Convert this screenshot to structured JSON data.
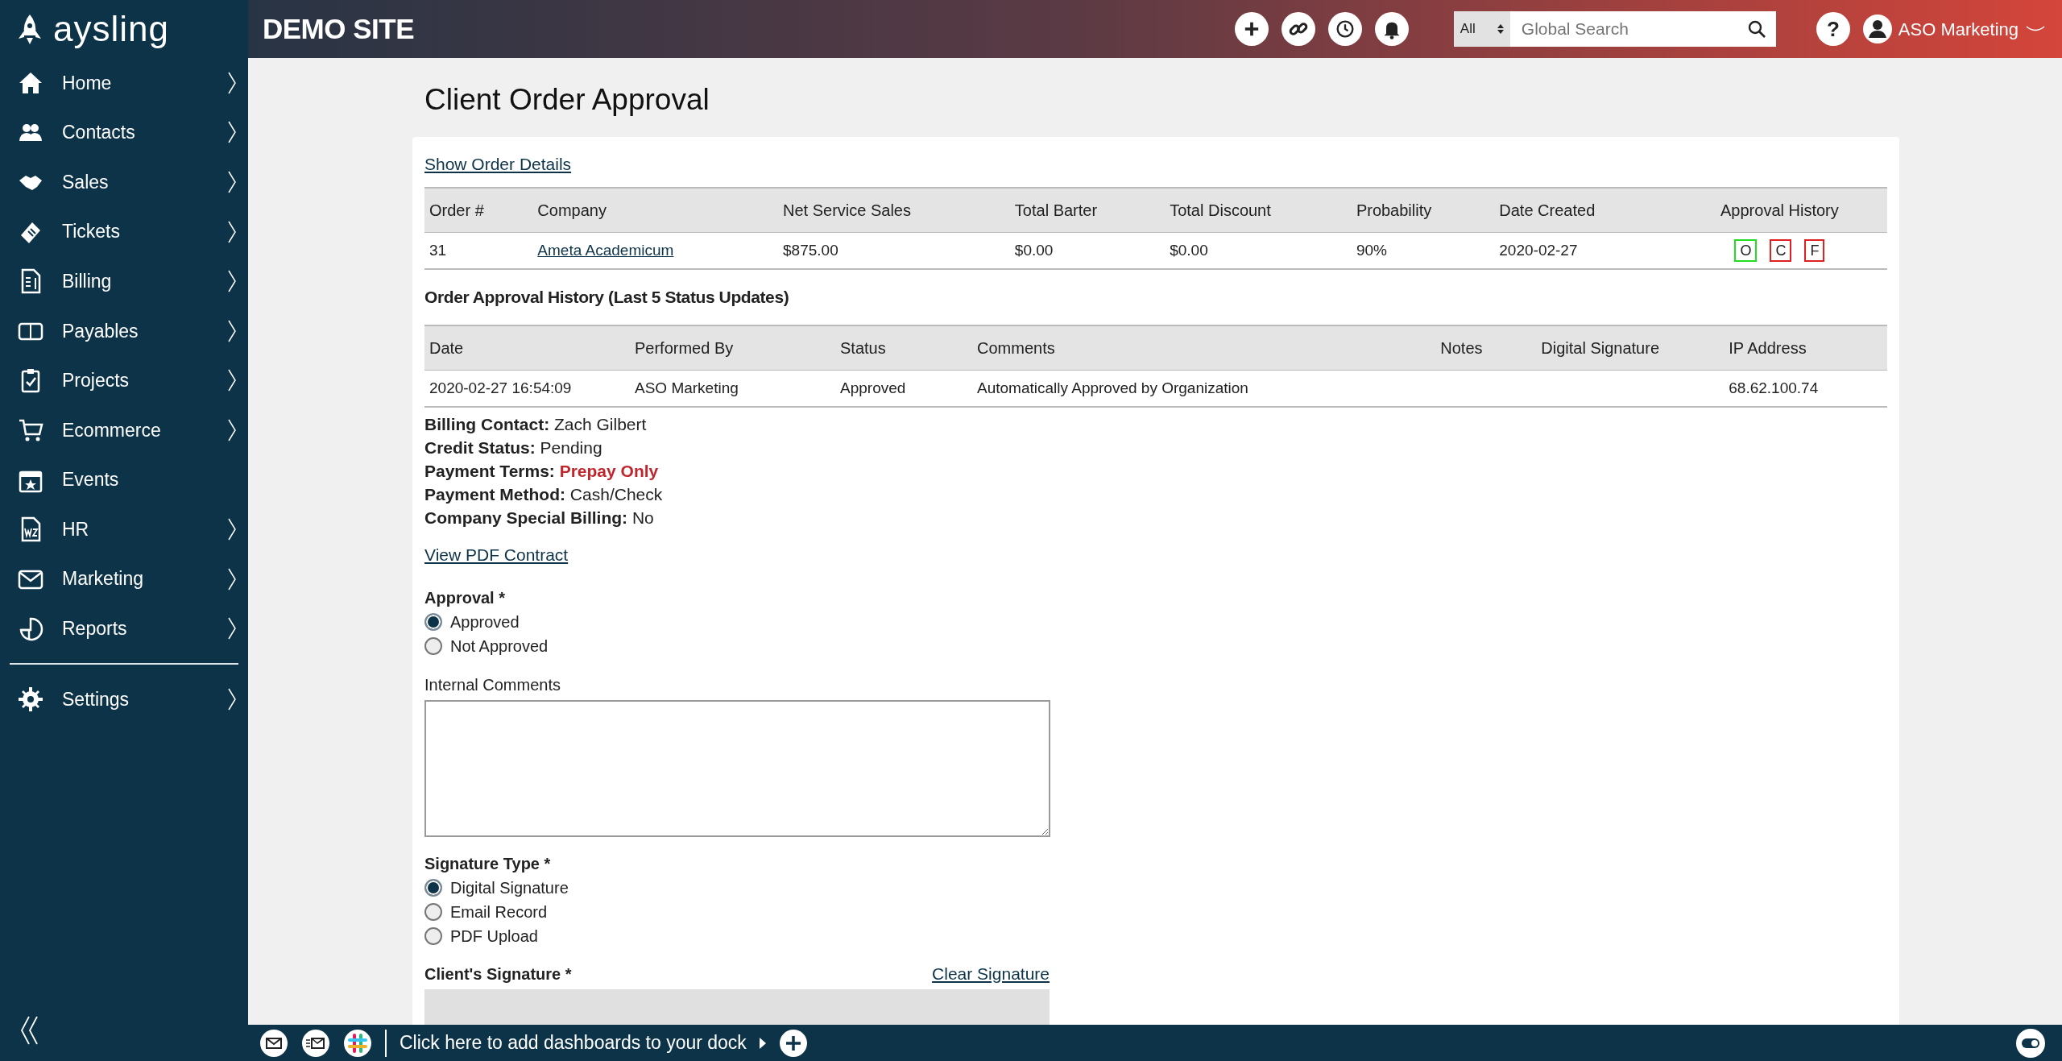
{
  "app": {
    "logo": "aysling",
    "site_title": "DEMO SITE"
  },
  "header": {
    "search_scope": "All",
    "search": {
      "placeholder": "Global Search"
    },
    "help": "?",
    "user": "ASO Marketing"
  },
  "sidebar": {
    "items": [
      {
        "label": "Home",
        "has_submenu": true
      },
      {
        "label": "Contacts",
        "has_submenu": true
      },
      {
        "label": "Sales",
        "has_submenu": true
      },
      {
        "label": "Tickets",
        "has_submenu": true
      },
      {
        "label": "Billing",
        "has_submenu": true
      },
      {
        "label": "Payables",
        "has_submenu": true
      },
      {
        "label": "Projects",
        "has_submenu": true
      },
      {
        "label": "Ecommerce",
        "has_submenu": true
      },
      {
        "label": "Events",
        "has_submenu": false
      },
      {
        "label": "HR",
        "has_submenu": true
      },
      {
        "label": "Marketing",
        "has_submenu": true
      },
      {
        "label": "Reports",
        "has_submenu": true
      }
    ],
    "settings": {
      "label": "Settings",
      "has_submenu": true
    }
  },
  "page": {
    "title": "Client Order Approval",
    "details_link": "Show Order Details",
    "order_table": {
      "columns": [
        {
          "label": "Order #",
          "kind": "text"
        },
        {
          "label": "Company",
          "kind": "link"
        },
        {
          "label": "Net Service Sales",
          "kind": "text"
        },
        {
          "label": "Total Barter",
          "kind": "text"
        },
        {
          "label": "Total Discount",
          "kind": "text"
        },
        {
          "label": "Probability",
          "kind": "text"
        },
        {
          "label": "Date Created",
          "kind": "text"
        },
        {
          "label": "Approval History",
          "kind": "badges"
        }
      ],
      "rows": [
        {
          "cells": [
            "31",
            "Ameta Academicum",
            "$875.00",
            "$0.00",
            "$0.00",
            "90%",
            "2020-02-27",
            [
              {
                "label": "O",
                "color": "#22dd22"
              },
              {
                "label": "C",
                "color": "#e02020"
              },
              {
                "label": "F",
                "color": "#e02020"
              }
            ]
          ]
        }
      ]
    },
    "history": {
      "title": "Order Approval History (Last 5 Status Updates)",
      "columns": [
        "Date",
        "Performed By",
        "Status",
        "Comments",
        "Notes",
        "Digital Signature",
        "IP Address"
      ],
      "rows": [
        {
          "cells": [
            "2020-02-27 16:54:09",
            "ASO Marketing",
            "Approved",
            "Automatically Approved by Organization",
            null,
            null,
            "68.62.100.74"
          ]
        }
      ]
    },
    "billing": [
      {
        "label": "Billing Contact:",
        "value": "Zach Gilbert",
        "alert": false
      },
      {
        "label": "Credit Status:",
        "value": "Pending",
        "alert": false
      },
      {
        "label": "Payment Terms:",
        "value": "Prepay Only",
        "alert": true
      },
      {
        "label": "Payment Method:",
        "value": "Cash/Check",
        "alert": false
      },
      {
        "label": "Company Special Billing:",
        "value": "No",
        "alert": false
      }
    ],
    "contract_link": "View PDF Contract",
    "approval": {
      "label": "Approval *",
      "options": [
        {
          "label": "Approved",
          "selected": true
        },
        {
          "label": "Not Approved",
          "selected": false
        }
      ]
    },
    "comments": {
      "label": "Internal Comments"
    },
    "signature_type": {
      "label": "Signature Type *",
      "options": [
        {
          "label": "Digital Signature",
          "selected": true
        },
        {
          "label": "Email Record",
          "selected": false
        },
        {
          "label": "PDF Upload",
          "selected": false
        }
      ]
    },
    "signature": {
      "label": "Client's Signature *",
      "clear_link": "Clear Signature"
    }
  },
  "dock": {
    "text": "Click here to add dashboards to your dock"
  }
}
